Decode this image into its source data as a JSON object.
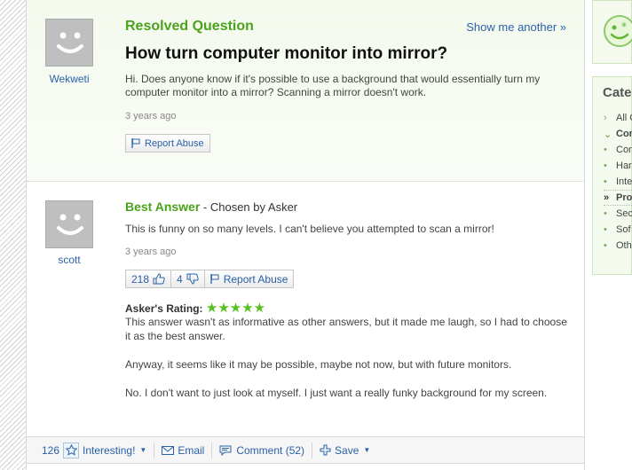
{
  "question": {
    "status": "Resolved Question",
    "show_another": "Show me another »",
    "title": "How turn computer monitor into mirror?",
    "body": "Hi. Does anyone know if it's possible to use a background that would essentially turn my computer monitor into a mirror? Scanning a mirror doesn't work.",
    "asker": "Wekweti",
    "time_ago": "3 years ago",
    "report_abuse": "Report Abuse"
  },
  "answer": {
    "label": "Best Answer",
    "chosen_by": " - Chosen by Asker",
    "user": "scott",
    "body": "This is funny on so many levels. I can't believe you attempted to scan a mirror!",
    "time_ago": "3 years ago",
    "thumbs_up": "218",
    "thumbs_down": "4",
    "report_abuse": "Report Abuse",
    "rating_label": "Asker's Rating:",
    "rating_stars": "★★★★★",
    "rating_value": 5,
    "comment": [
      "This answer wasn't as informative as other answers, but it made me laugh, so I had to choose it as the best answer.",
      "Anyway, it seems like it may be possible, maybe not now, but with future monitors.",
      "No. I don't want to just look at myself. I just want a really funky background for my screen."
    ]
  },
  "footer": {
    "interesting_count": "126",
    "interesting": "Interesting!",
    "email": "Email",
    "comment": "Comment (52)",
    "save": "Save"
  },
  "sidebar": {
    "categories_title": "Cate",
    "items": [
      {
        "marker": "›",
        "label": "All C"
      },
      {
        "marker": "⌄",
        "label": "Con",
        "bold": true
      },
      {
        "marker": "•",
        "label": "Con"
      },
      {
        "marker": "•",
        "label": "Har"
      },
      {
        "marker": "•",
        "label": "Inte"
      },
      {
        "marker": "»",
        "label": "Pro",
        "bold": true
      },
      {
        "marker": "•",
        "label": "Sec"
      },
      {
        "marker": "•",
        "label": "Sof"
      },
      {
        "marker": "•",
        "label": "Oth"
      }
    ]
  },
  "colors": {
    "brand_green": "#4ba31c",
    "link_blue": "#2a61a9",
    "star_green": "#55c11f"
  }
}
